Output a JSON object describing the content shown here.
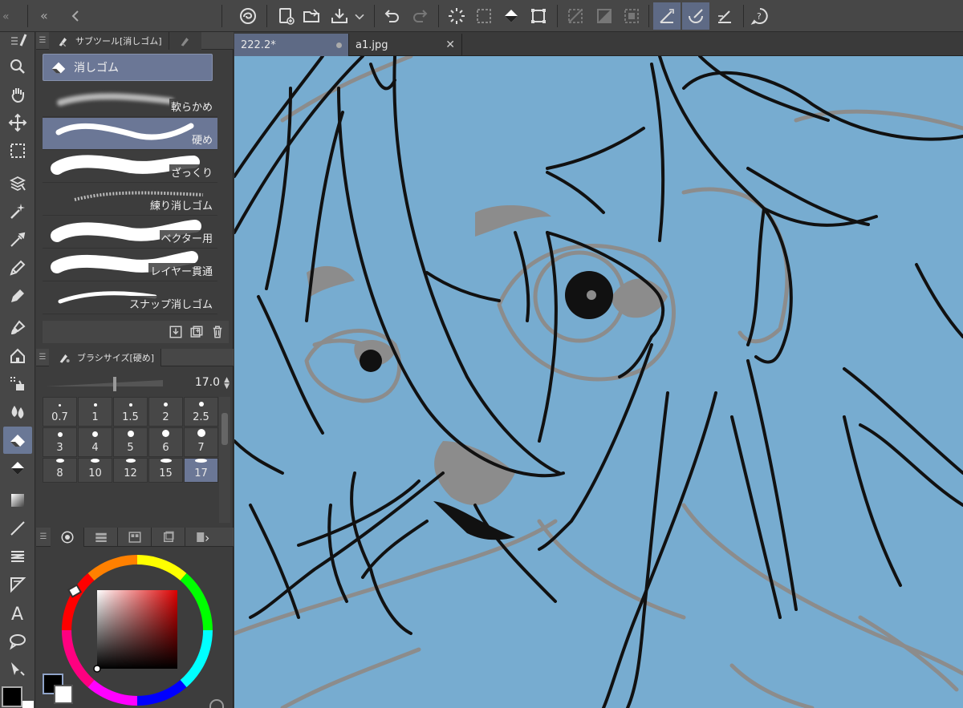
{
  "window": {
    "tabs": [
      {
        "label": "222.2*",
        "active": true
      },
      {
        "label": "a1.jpg",
        "active": false
      }
    ]
  },
  "subtool_panel": {
    "title": "サブツール[消しゴム]",
    "current_tool": "消しゴム",
    "brushes": [
      {
        "label": "軟らかめ",
        "selected": false
      },
      {
        "label": "硬め",
        "selected": true
      },
      {
        "label": "ざっくり",
        "selected": false
      },
      {
        "label": "練り消しゴム",
        "selected": false
      },
      {
        "label": "ベクター用",
        "selected": false
      },
      {
        "label": "レイヤー貫通",
        "selected": false
      },
      {
        "label": "スナップ消しゴム",
        "selected": false
      }
    ]
  },
  "brush_size_panel": {
    "title": "ブラシサイズ[硬め]",
    "value": "17.0",
    "presets": [
      "0.7",
      "1",
      "1.5",
      "2",
      "2.5",
      "3",
      "4",
      "5",
      "6",
      "7",
      "8",
      "10",
      "12",
      "15",
      "17"
    ],
    "selected_preset": "17"
  },
  "colors": {
    "accent": "#6b7796",
    "canvas_bg": "#77acd0",
    "main_color": "#000000",
    "sub_color": "#ffffff",
    "picker_hue": "#dd0000"
  },
  "icons": {
    "tools": [
      "zoom-icon",
      "hand-icon",
      "move-icon",
      "selection-icon",
      "auto-select-icon",
      "magic-wand-icon",
      "eyedropper-icon",
      "pen-icon",
      "pencil-icon",
      "brush-icon",
      "airbrush-icon",
      "decoration-icon",
      "blend-icon",
      "eraser-icon",
      "fill-icon",
      "gradient-icon",
      "line-icon",
      "frame-icon",
      "ruler-icon",
      "text-icon",
      "balloon-icon",
      "correct-line-icon"
    ],
    "commandbar": [
      "app-logo-icon",
      "new-icon",
      "open-icon",
      "save-icon",
      "undo-icon",
      "redo-icon",
      "clear-icon",
      "transform-icon",
      "fill-icon",
      "select-bounds-icon",
      "snap-off-icon",
      "snap-ruler-icon",
      "snap-special-icon",
      "help-icon"
    ]
  }
}
